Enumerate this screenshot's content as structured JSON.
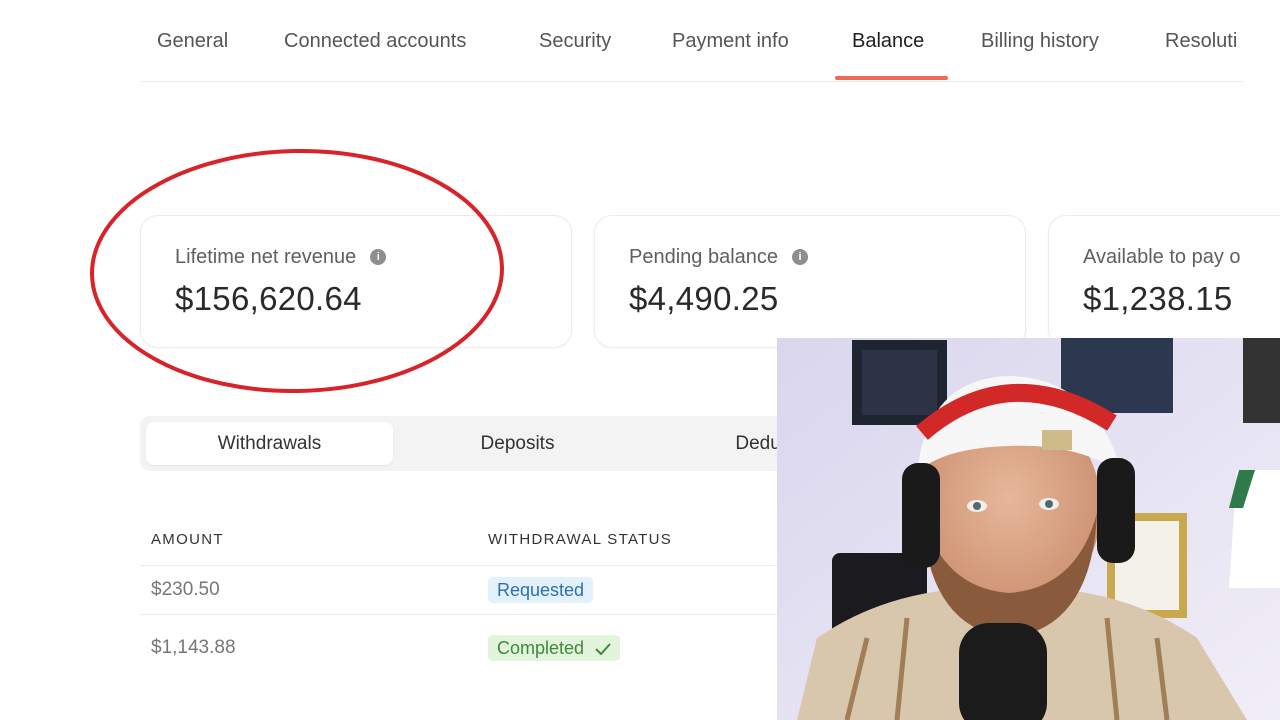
{
  "tabs": [
    {
      "label": "General"
    },
    {
      "label": "Connected accounts"
    },
    {
      "label": "Security"
    },
    {
      "label": "Payment info"
    },
    {
      "label": "Balance",
      "active": true
    },
    {
      "label": "Billing history"
    },
    {
      "label": "Resoluti"
    }
  ],
  "cards": [
    {
      "label": "Lifetime net revenue",
      "value": "$156,620.64"
    },
    {
      "label": "Pending balance",
      "value": "$4,490.25"
    },
    {
      "label": "Available to pay o",
      "value": "$1,238.15"
    }
  ],
  "segments": [
    {
      "label": "Withdrawals",
      "active": true
    },
    {
      "label": "Deposits"
    },
    {
      "label": "Deduct"
    }
  ],
  "table": {
    "headers": [
      "AMOUNT",
      "WITHDRAWAL STATUS"
    ],
    "rows": [
      {
        "amount": "$230.50",
        "status": "Requested"
      },
      {
        "amount": "$1,143.88",
        "status": "Completed"
      }
    ]
  },
  "colors": {
    "accent": "#ec6a56",
    "annotation": "#d8232a",
    "requested_bg": "#e2f1fc",
    "completed_bg": "#e2f5dc"
  },
  "icons": {
    "info": "info-icon",
    "check": "check-icon"
  }
}
